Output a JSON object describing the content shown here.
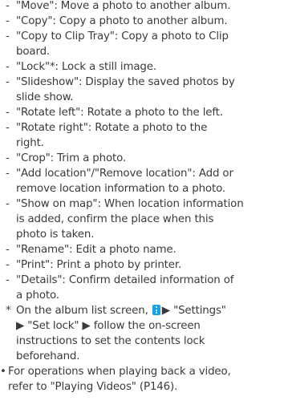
{
  "colors": {
    "text": "#3a3a3a",
    "menu_icon_accent": "#1aa0e6"
  },
  "icons": {
    "menu": "menu-icon",
    "arrow": "arrow-right-icon"
  },
  "symbols": {
    "dash": "-",
    "asterisk": "*",
    "bullet": "•",
    "arrow": "▶"
  },
  "menu_items": [
    {
      "lines": [
        "\"Move\": Move a photo to another album."
      ]
    },
    {
      "lines": [
        "\"Copy\": Copy a photo to another album."
      ]
    },
    {
      "lines": [
        "\"Copy to Clip Tray\": Copy a photo to Clip",
        "board."
      ]
    },
    {
      "lines": [
        "\"Lock\"*: Lock a still image."
      ]
    },
    {
      "lines": [
        "\"Slideshow\": Display the saved photos by",
        "slide show."
      ]
    },
    {
      "lines": [
        "\"Rotate left\": Rotate a photo to the left."
      ]
    },
    {
      "lines": [
        "\"Rotate right\": Rotate a photo to the",
        "right."
      ]
    },
    {
      "lines": [
        "\"Crop\": Trim a photo."
      ]
    },
    {
      "lines": [
        "\"Add location\"/\"Remove location\": Add or",
        "remove location information to a photo."
      ]
    },
    {
      "lines": [
        "\"Show on map\": When location information",
        "is added, confirm the place when this",
        "photo is taken."
      ]
    },
    {
      "lines": [
        "\"Rename\": Edit a photo name."
      ]
    },
    {
      "lines": [
        "\"Print\": Print a photo by printer."
      ]
    },
    {
      "lines": [
        "\"Details\": Confirm detailed information of",
        "a photo."
      ]
    }
  ],
  "footnote": {
    "line1_prefix": "On the album list screen,",
    "line1_settings": "\"Settings\"",
    "line2_set_lock": "\"Set lock\"",
    "line2_rest": "follow the on-screen",
    "line3": "instructions to set the contents lock",
    "line4": "beforehand."
  },
  "bullet_item": {
    "lines": [
      "For operations when playing back a video,",
      "refer to \"Playing Videos\" (P146)."
    ]
  }
}
